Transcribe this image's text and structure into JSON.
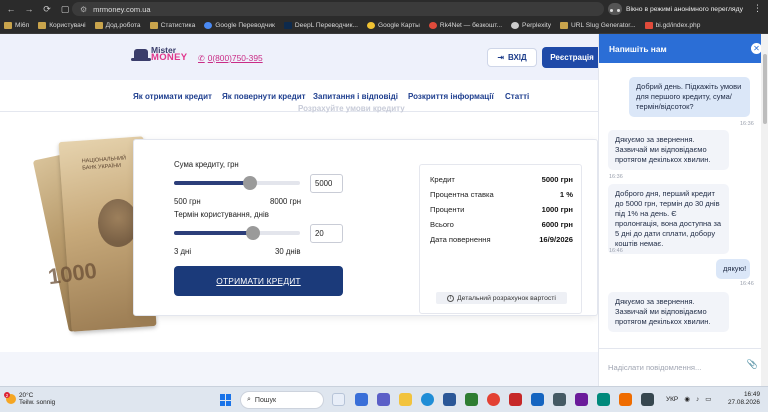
{
  "browser": {
    "url": "mrmoney.com.ua",
    "incognito_label": "Вікно в режимі анонімного перегляду",
    "bookmarks": [
      "Мі6п",
      "Користувачі",
      "Дод.робота",
      "Статистика",
      "Google Переводчик",
      "DeepL Переводчик...",
      "Google Карты",
      "Rk4Net — безкошт...",
      "Perplexity",
      "URL Slug Generator...",
      "bi.gd/index.php"
    ]
  },
  "header": {
    "logo_line1": "Mister",
    "logo_line2": "MONEY",
    "phone": "0(800)750-395",
    "login_label": "ВХІД",
    "register_label": "Реєстрація"
  },
  "menu": [
    "Як отримати кредит",
    "Як повернути кредит",
    "Запитання і відповіді",
    "Розкриття інформації",
    "Статті"
  ],
  "faded_title": "Розрахуйте умови кредиту",
  "banknote": {
    "text_line1": "НАЦІОНАЛЬНИЙ",
    "text_line2": "БАНК УКРАЇНИ",
    "denomination": "1000"
  },
  "calculator": {
    "amount_label": "Сума кредиту, грн",
    "amount_value": "5000",
    "amount_min": "500 грн",
    "amount_max": "8000 грн",
    "amount_fraction": 0.6,
    "term_label": "Термін користування, днів",
    "term_value": "20",
    "term_min": "3 дні",
    "term_max": "30 днів",
    "term_fraction": 0.63,
    "cta_label": "ОТРИМАТИ КРЕДИТ"
  },
  "summary": {
    "rows": [
      {
        "k": "Кредит",
        "v": "5000 грн"
      },
      {
        "k": "Процентна ставка",
        "v": "1 %"
      },
      {
        "k": "Проценти",
        "v": "1000 грн"
      },
      {
        "k": "Всього",
        "v": "6000 грн"
      },
      {
        "k": "Дата повернення",
        "v": "16/9/2026"
      }
    ],
    "detail_label": "Детальний розрахунок вартості"
  },
  "chat": {
    "title": "Напишіть нам",
    "messages": [
      {
        "dir": "out",
        "text": "Добрий день. Підкажіть умови для першого кредиту, сума/термін/відсоток?",
        "time": "16:36"
      },
      {
        "dir": "in",
        "text": "Дякуємо за звернення. Зазвичай ми відповідаємо протягом декількох хвилин.",
        "time": "16:36"
      },
      {
        "dir": "in",
        "text": "Доброго дня, перший кредит до 5000 грн, термін до 30 днів під 1% на день. Є пролонгація, вона доступна за 5 дні до дати сплати, добору коштів немає.",
        "time": "16:46"
      },
      {
        "dir": "out",
        "text": "дякую!",
        "time": "16:46"
      },
      {
        "dir": "in",
        "text": "Дякуємо за звернення. Зазвичай ми відповідаємо протягом декількох хвилин.",
        "time": ""
      }
    ],
    "input_placeholder": "Надіслати повідомлення..."
  },
  "taskbar": {
    "weather_temp": "20°C",
    "weather_desc": "Teilw. sonnig",
    "weather_badge": "2",
    "search_label": "Пошук",
    "lang": "УКР",
    "time": "16:49",
    "date": "27.08.2026"
  }
}
